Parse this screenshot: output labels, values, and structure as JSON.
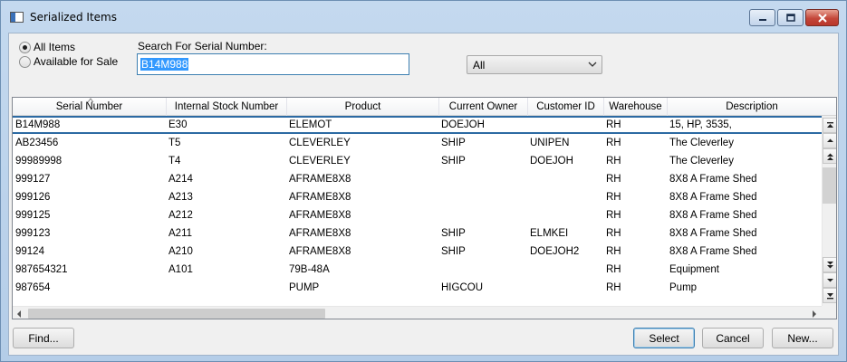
{
  "window": {
    "title": "Serialized Items"
  },
  "filters": {
    "all_items_label": "All Items",
    "available_label": "Available for Sale",
    "all_items_checked": true
  },
  "search": {
    "label": "Search For Serial Number:",
    "value": "B14M988"
  },
  "filter_combo": {
    "value": "All"
  },
  "grid": {
    "columns": [
      "Serial Number",
      "Internal Stock Number",
      "Product",
      "Current Owner",
      "Customer ID",
      "Warehouse",
      "Description"
    ],
    "rows": [
      [
        "B14M988",
        "E30",
        "ELEMOT",
        "DOEJOH",
        "",
        "RH",
        "15, HP, 3535,"
      ],
      [
        "AB23456",
        "T5",
        "CLEVERLEY",
        "SHIP",
        "UNIPEN",
        "RH",
        "The Cleverley"
      ],
      [
        "99989998",
        "T4",
        "CLEVERLEY",
        "SHIP",
        "DOEJOH",
        "RH",
        "The Cleverley"
      ],
      [
        "999127",
        "A214",
        "AFRAME8X8",
        "",
        "",
        "RH",
        "8X8 A Frame Shed"
      ],
      [
        "999126",
        "A213",
        "AFRAME8X8",
        "",
        "",
        "RH",
        "8X8 A Frame Shed"
      ],
      [
        "999125",
        "A212",
        "AFRAME8X8",
        "",
        "",
        "RH",
        "8X8 A Frame Shed"
      ],
      [
        "999123",
        "A211",
        "AFRAME8X8",
        "SHIP",
        "ELMKEI",
        "RH",
        "8X8 A Frame Shed"
      ],
      [
        "99124",
        "A210",
        "AFRAME8X8",
        "SHIP",
        "DOEJOH2",
        "RH",
        "8X8 A Frame Shed"
      ],
      [
        "987654321",
        "A101",
        "79B-48A",
        "",
        "",
        "RH",
        "Equipment"
      ],
      [
        "987654",
        "",
        "PUMP",
        "HIGCOU",
        "",
        "RH",
        "Pump"
      ]
    ],
    "selected_row": 0
  },
  "buttons": {
    "find": "Find...",
    "select": "Select",
    "cancel": "Cancel",
    "new": "New..."
  },
  "colors": {
    "selection_border": "#2c6aa3",
    "search_highlight": "#3399ff",
    "close_button": "#c4473a"
  }
}
